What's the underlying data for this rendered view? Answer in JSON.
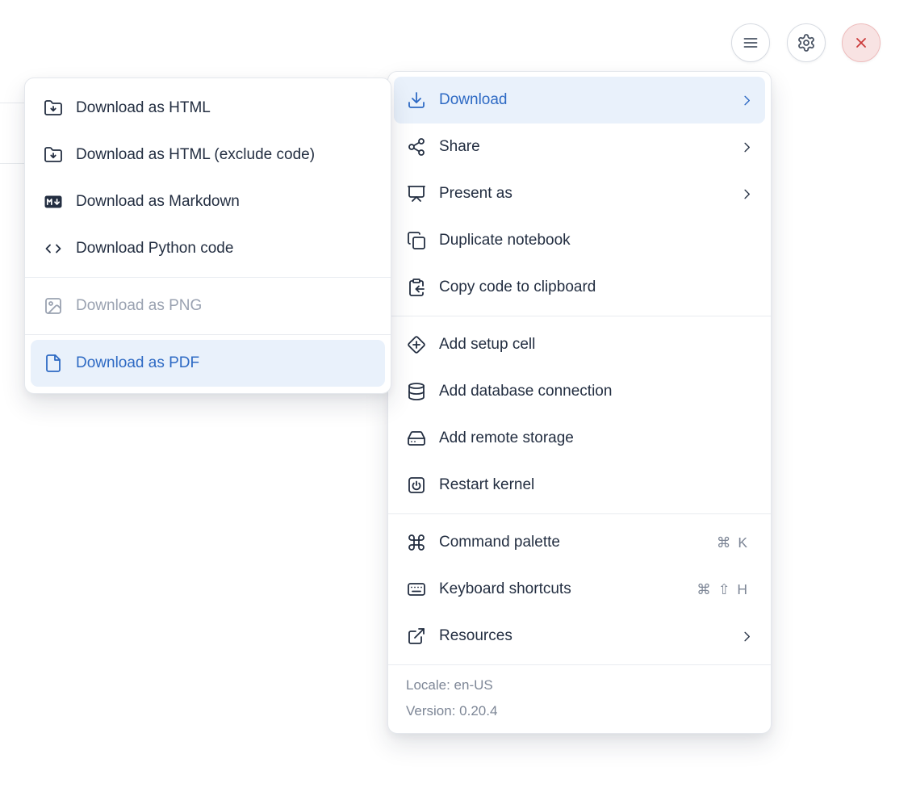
{
  "toolbar": {
    "buttons": [
      {
        "name": "menu",
        "icon": "hamburger-icon",
        "style": "default"
      },
      {
        "name": "settings",
        "icon": "gear-icon",
        "style": "default"
      },
      {
        "name": "close",
        "icon": "close-icon",
        "style": "danger"
      }
    ]
  },
  "download_submenu": {
    "items": [
      {
        "label": "Download as HTML",
        "icon": "folder-down-icon"
      },
      {
        "label": "Download as HTML (exclude code)",
        "icon": "folder-down-icon"
      },
      {
        "label": "Download as Markdown",
        "icon": "markdown-icon"
      },
      {
        "label": "Download Python code",
        "icon": "code-icon"
      },
      {
        "divider": true
      },
      {
        "label": "Download as PNG",
        "icon": "image-icon",
        "disabled": true
      },
      {
        "divider": true
      },
      {
        "label": "Download as PDF",
        "icon": "file-icon",
        "highlighted": true
      }
    ]
  },
  "main_menu": {
    "items": [
      {
        "label": "Download",
        "icon": "download-icon",
        "chevron": true,
        "highlighted": true
      },
      {
        "label": "Share",
        "icon": "share-icon",
        "chevron": true
      },
      {
        "label": "Present as",
        "icon": "presentation-icon",
        "chevron": true
      },
      {
        "label": "Duplicate notebook",
        "icon": "duplicate-icon"
      },
      {
        "label": "Copy code to clipboard",
        "icon": "clipboard-copy-icon"
      },
      {
        "divider": true
      },
      {
        "label": "Add setup cell",
        "icon": "diamond-plus-icon"
      },
      {
        "label": "Add database connection",
        "icon": "database-icon"
      },
      {
        "label": "Add remote storage",
        "icon": "hard-drive-icon"
      },
      {
        "label": "Restart kernel",
        "icon": "power-square-icon"
      },
      {
        "divider": true
      },
      {
        "label": "Command palette",
        "icon": "command-icon",
        "shortcut": [
          "⌘",
          "K"
        ]
      },
      {
        "label": "Keyboard shortcuts",
        "icon": "keyboard-icon",
        "shortcut": [
          "⌘",
          "⇧",
          "H"
        ]
      },
      {
        "label": "Resources",
        "icon": "external-link-icon",
        "chevron": true
      }
    ],
    "footer": [
      "Locale: en-US",
      "Version: 0.20.4"
    ]
  },
  "colors": {
    "accent_blue": "#2e6ac4",
    "highlight_bg": "#e9f1fb",
    "text": "#232e41",
    "muted_gray": "#7d8696",
    "disabled_gray": "#9aa2b1",
    "danger_red": "#cb3a3a",
    "danger_bg": "#f8e3e3",
    "border": "#e4e7ec"
  }
}
